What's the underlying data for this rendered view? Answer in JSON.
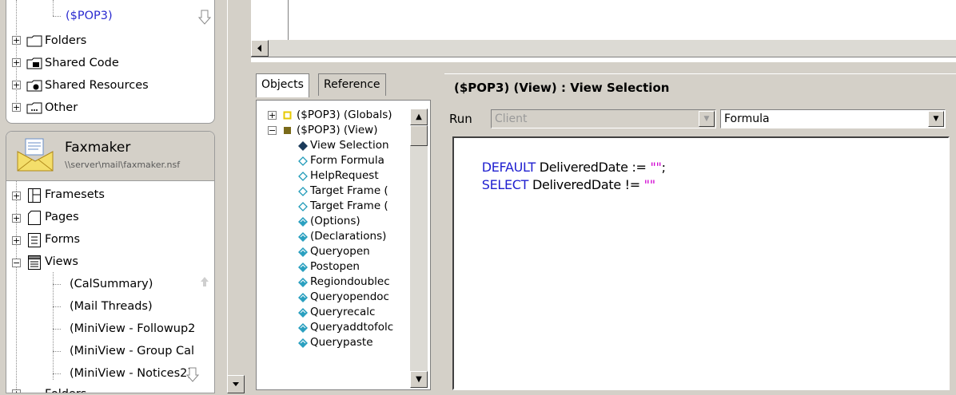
{
  "left_navigator": {
    "top_tree": [
      {
        "label": "($POP3)",
        "type": "view-item"
      },
      {
        "label": "Folders",
        "type": "folder"
      },
      {
        "label": "Shared Code",
        "type": "shared-code"
      },
      {
        "label": "Shared Resources",
        "type": "shared-resources"
      },
      {
        "label": "Other",
        "type": "other"
      }
    ],
    "database": {
      "title": "Faxmaker",
      "path": "\\\\server\\mail\\faxmaker.nsf"
    },
    "bottom_tree": [
      {
        "label": "Framesets",
        "expander": "+"
      },
      {
        "label": "Pages",
        "expander": "+"
      },
      {
        "label": "Forms",
        "expander": "+"
      },
      {
        "label": "Views",
        "expander": "−"
      }
    ],
    "views_children": [
      "(CalSummary)",
      "(Mail Threads)",
      "(MiniView - Followup2",
      "(MiniView - Group Cal",
      "(MiniView - Notices2)"
    ],
    "partial_last_item": "Folders"
  },
  "object_browser": {
    "tabs": [
      "Objects",
      "Reference"
    ],
    "active_tab": "Objects",
    "items": [
      {
        "label": "($POP3) (Globals)",
        "expander": "+",
        "icon": "globals-square-icon",
        "indent": 0
      },
      {
        "label": "($POP3) (View)",
        "expander": "−",
        "icon": "view-square-icon",
        "indent": 0
      },
      {
        "label": "View Selection",
        "icon": "filled-diamond-icon",
        "indent": 1
      },
      {
        "label": "Form Formula",
        "icon": "outline-diamond-icon",
        "indent": 1
      },
      {
        "label": "HelpRequest",
        "icon": "outline-diamond-icon",
        "indent": 1
      },
      {
        "label": "Target Frame (",
        "icon": "outline-diamond-icon",
        "indent": 1
      },
      {
        "label": "Target Frame (",
        "icon": "outline-diamond-icon",
        "indent": 1
      },
      {
        "label": "(Options)",
        "icon": "script-diamond-icon",
        "indent": 1
      },
      {
        "label": "(Declarations)",
        "icon": "script-diamond-icon",
        "indent": 1
      },
      {
        "label": "Queryopen",
        "icon": "script-diamond-icon",
        "indent": 1
      },
      {
        "label": "Postopen",
        "icon": "script-diamond-icon",
        "indent": 1
      },
      {
        "label": "Regiondoublec",
        "icon": "script-diamond-icon",
        "indent": 1
      },
      {
        "label": "Queryopendoc",
        "icon": "script-diamond-icon",
        "indent": 1
      },
      {
        "label": "Queryrecalc",
        "icon": "script-diamond-icon",
        "indent": 1
      },
      {
        "label": "Queryaddtofolc",
        "icon": "script-diamond-icon",
        "indent": 1
      },
      {
        "label": "Querypaste",
        "icon": "script-diamond-icon",
        "indent": 1
      }
    ]
  },
  "programmer_pane": {
    "title": "($POP3) (View) : View Selection",
    "run_label": "Run",
    "run_value": "Client",
    "language_value": "Formula",
    "code": [
      [
        {
          "t": "DEFAULT",
          "c": "kw"
        },
        {
          "t": " DeliveredDate := ",
          "c": "id"
        },
        {
          "t": "\"\"",
          "c": "str"
        },
        {
          "t": ";",
          "c": "id"
        }
      ],
      [
        {
          "t": "SELECT",
          "c": "kw"
        },
        {
          "t": " DeliveredDate != ",
          "c": "id"
        },
        {
          "t": "\"\"",
          "c": "str"
        }
      ]
    ]
  },
  "colors": {
    "keyword": "#1f1fd0",
    "string": "#d100d1",
    "link": "#2a2ad0",
    "chrome": "#d4d0c8"
  }
}
